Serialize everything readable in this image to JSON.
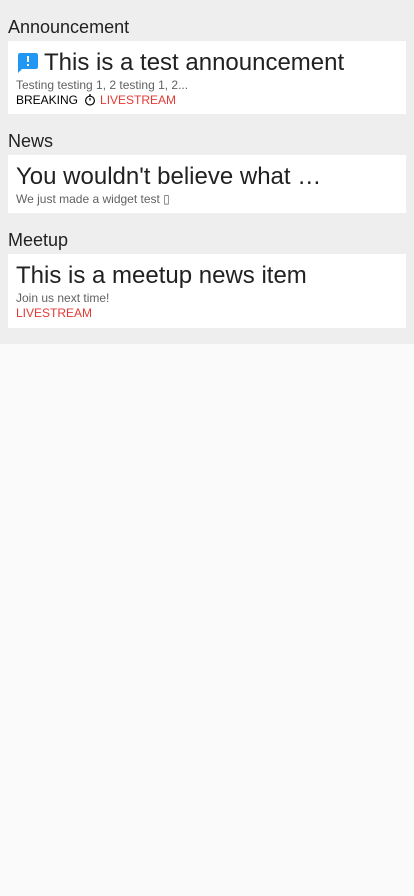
{
  "sections": [
    {
      "title": "Announcement",
      "item": {
        "icon": "announcement-icon",
        "headline": "This is a test announcement",
        "subtitle": "Testing testing 1, 2 testing 1, 2...",
        "tag_breaking": "BREAKING",
        "tag_icon": "stopwatch-icon",
        "tag_live": "LIVESTREAM"
      }
    },
    {
      "title": "News",
      "item": {
        "headline": "You wouldn't believe what …",
        "subtitle": "We just made a widget test ▯"
      }
    },
    {
      "title": "Meetup",
      "item": {
        "headline": "This is a meetup news item",
        "subtitle": "Join us next time!",
        "tag_live": "LIVESTREAM"
      }
    }
  ],
  "colors": {
    "accent": "#2196f3",
    "live": "#e53935",
    "panel": "#eeeeee",
    "card": "#ffffff",
    "page": "#fafafa"
  }
}
